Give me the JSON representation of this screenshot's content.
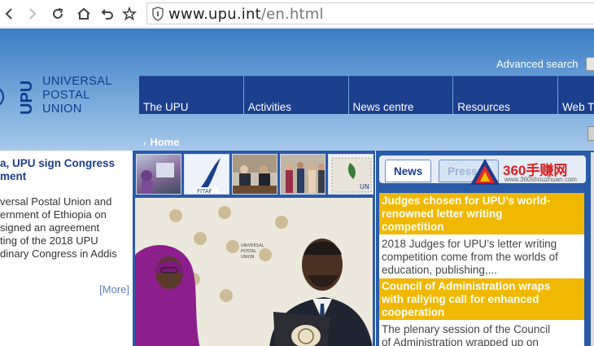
{
  "browser": {
    "url_host": "www.upu.int",
    "url_path": "/en.html"
  },
  "header": {
    "logo_acronym": "UPU",
    "logo_lines": [
      "UNIVERSAL",
      "POSTAL",
      "UNION"
    ],
    "advanced_search": "Advanced search",
    "nav": [
      "The UPU",
      "Activities",
      "News centre",
      "Resources",
      "Web T"
    ],
    "breadcrumb": "Home"
  },
  "left_story": {
    "title_lines": [
      "a, UPU sign Congress",
      "ment"
    ],
    "body_lines": [
      "versal Postal Union and",
      "ernment of Ethiopia on",
      " signed an agreement",
      "ting of the 2018 UPU",
      "dinary Congress in Addis"
    ],
    "more": "[More]"
  },
  "media": {
    "thumbnail_count": 5
  },
  "tabs": {
    "active": "News",
    "inactive": "Press"
  },
  "watermark": {
    "text": "360手赚网",
    "sub": "www.360shouzhuan.com"
  },
  "news": [
    {
      "title_lines": [
        "Judges chosen for UPU’s world-",
        "renowned letter writing",
        "competition"
      ],
      "summary_lines": [
        "2018 Judges for UPU’s letter writing",
        "competition come from the worlds of",
        "education, publishing,..."
      ]
    },
    {
      "title_lines": [
        "Council of Administration wraps",
        "with rallying call for enhanced",
        "cooperation"
      ],
      "summary_lines": [
        "The plenary session of the Council",
        "of Administration wrapped up on"
      ]
    }
  ],
  "colors": {
    "nav_blue": "#1c3f8e",
    "accent_yellow": "#f0b800",
    "header_gradient_top": "#3a7cc4"
  }
}
